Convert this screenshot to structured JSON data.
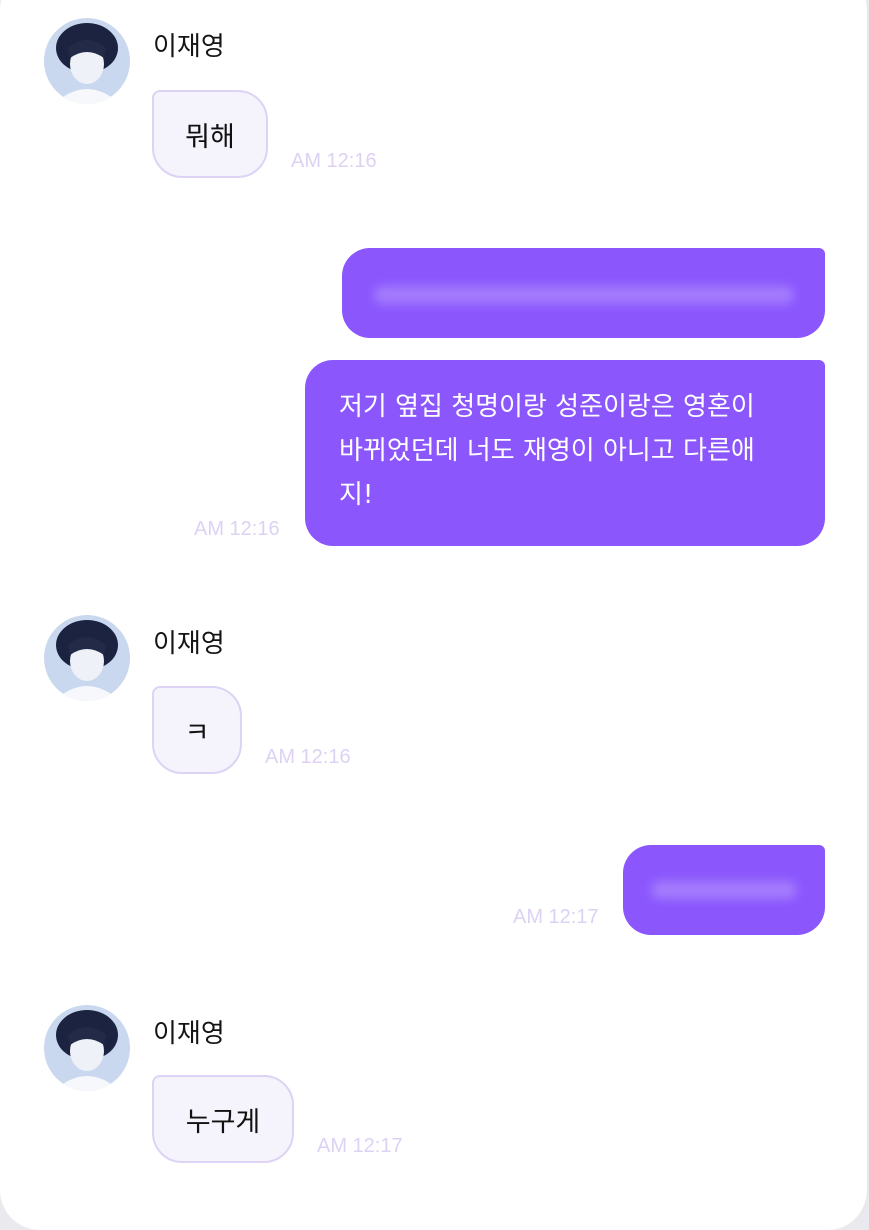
{
  "colors": {
    "outgoing_bubble": "#8b57fd",
    "incoming_bubble": "#f5f3fb",
    "incoming_border": "#ddd3f5",
    "timestamp": "#ddd2f3"
  },
  "messages": [
    {
      "direction": "incoming",
      "sender": "이재영",
      "text": "뭐해",
      "time": "AM 12:16"
    },
    {
      "direction": "outgoing",
      "text": "",
      "time": "",
      "redacted": true
    },
    {
      "direction": "outgoing",
      "lines": [
        "저기 옆집 청명이랑 성준이랑은 영혼이",
        "바뀌었던데 너도 재영이 아니고 다른애",
        "지!"
      ],
      "time": "AM 12:16"
    },
    {
      "direction": "incoming",
      "sender": "이재영",
      "text": "ㅋ",
      "time": "AM 12:16"
    },
    {
      "direction": "outgoing",
      "text": "",
      "time": "AM 12:17",
      "redacted": true
    },
    {
      "direction": "incoming",
      "sender": "이재영",
      "text": "누구게",
      "time": "AM 12:17"
    }
  ]
}
